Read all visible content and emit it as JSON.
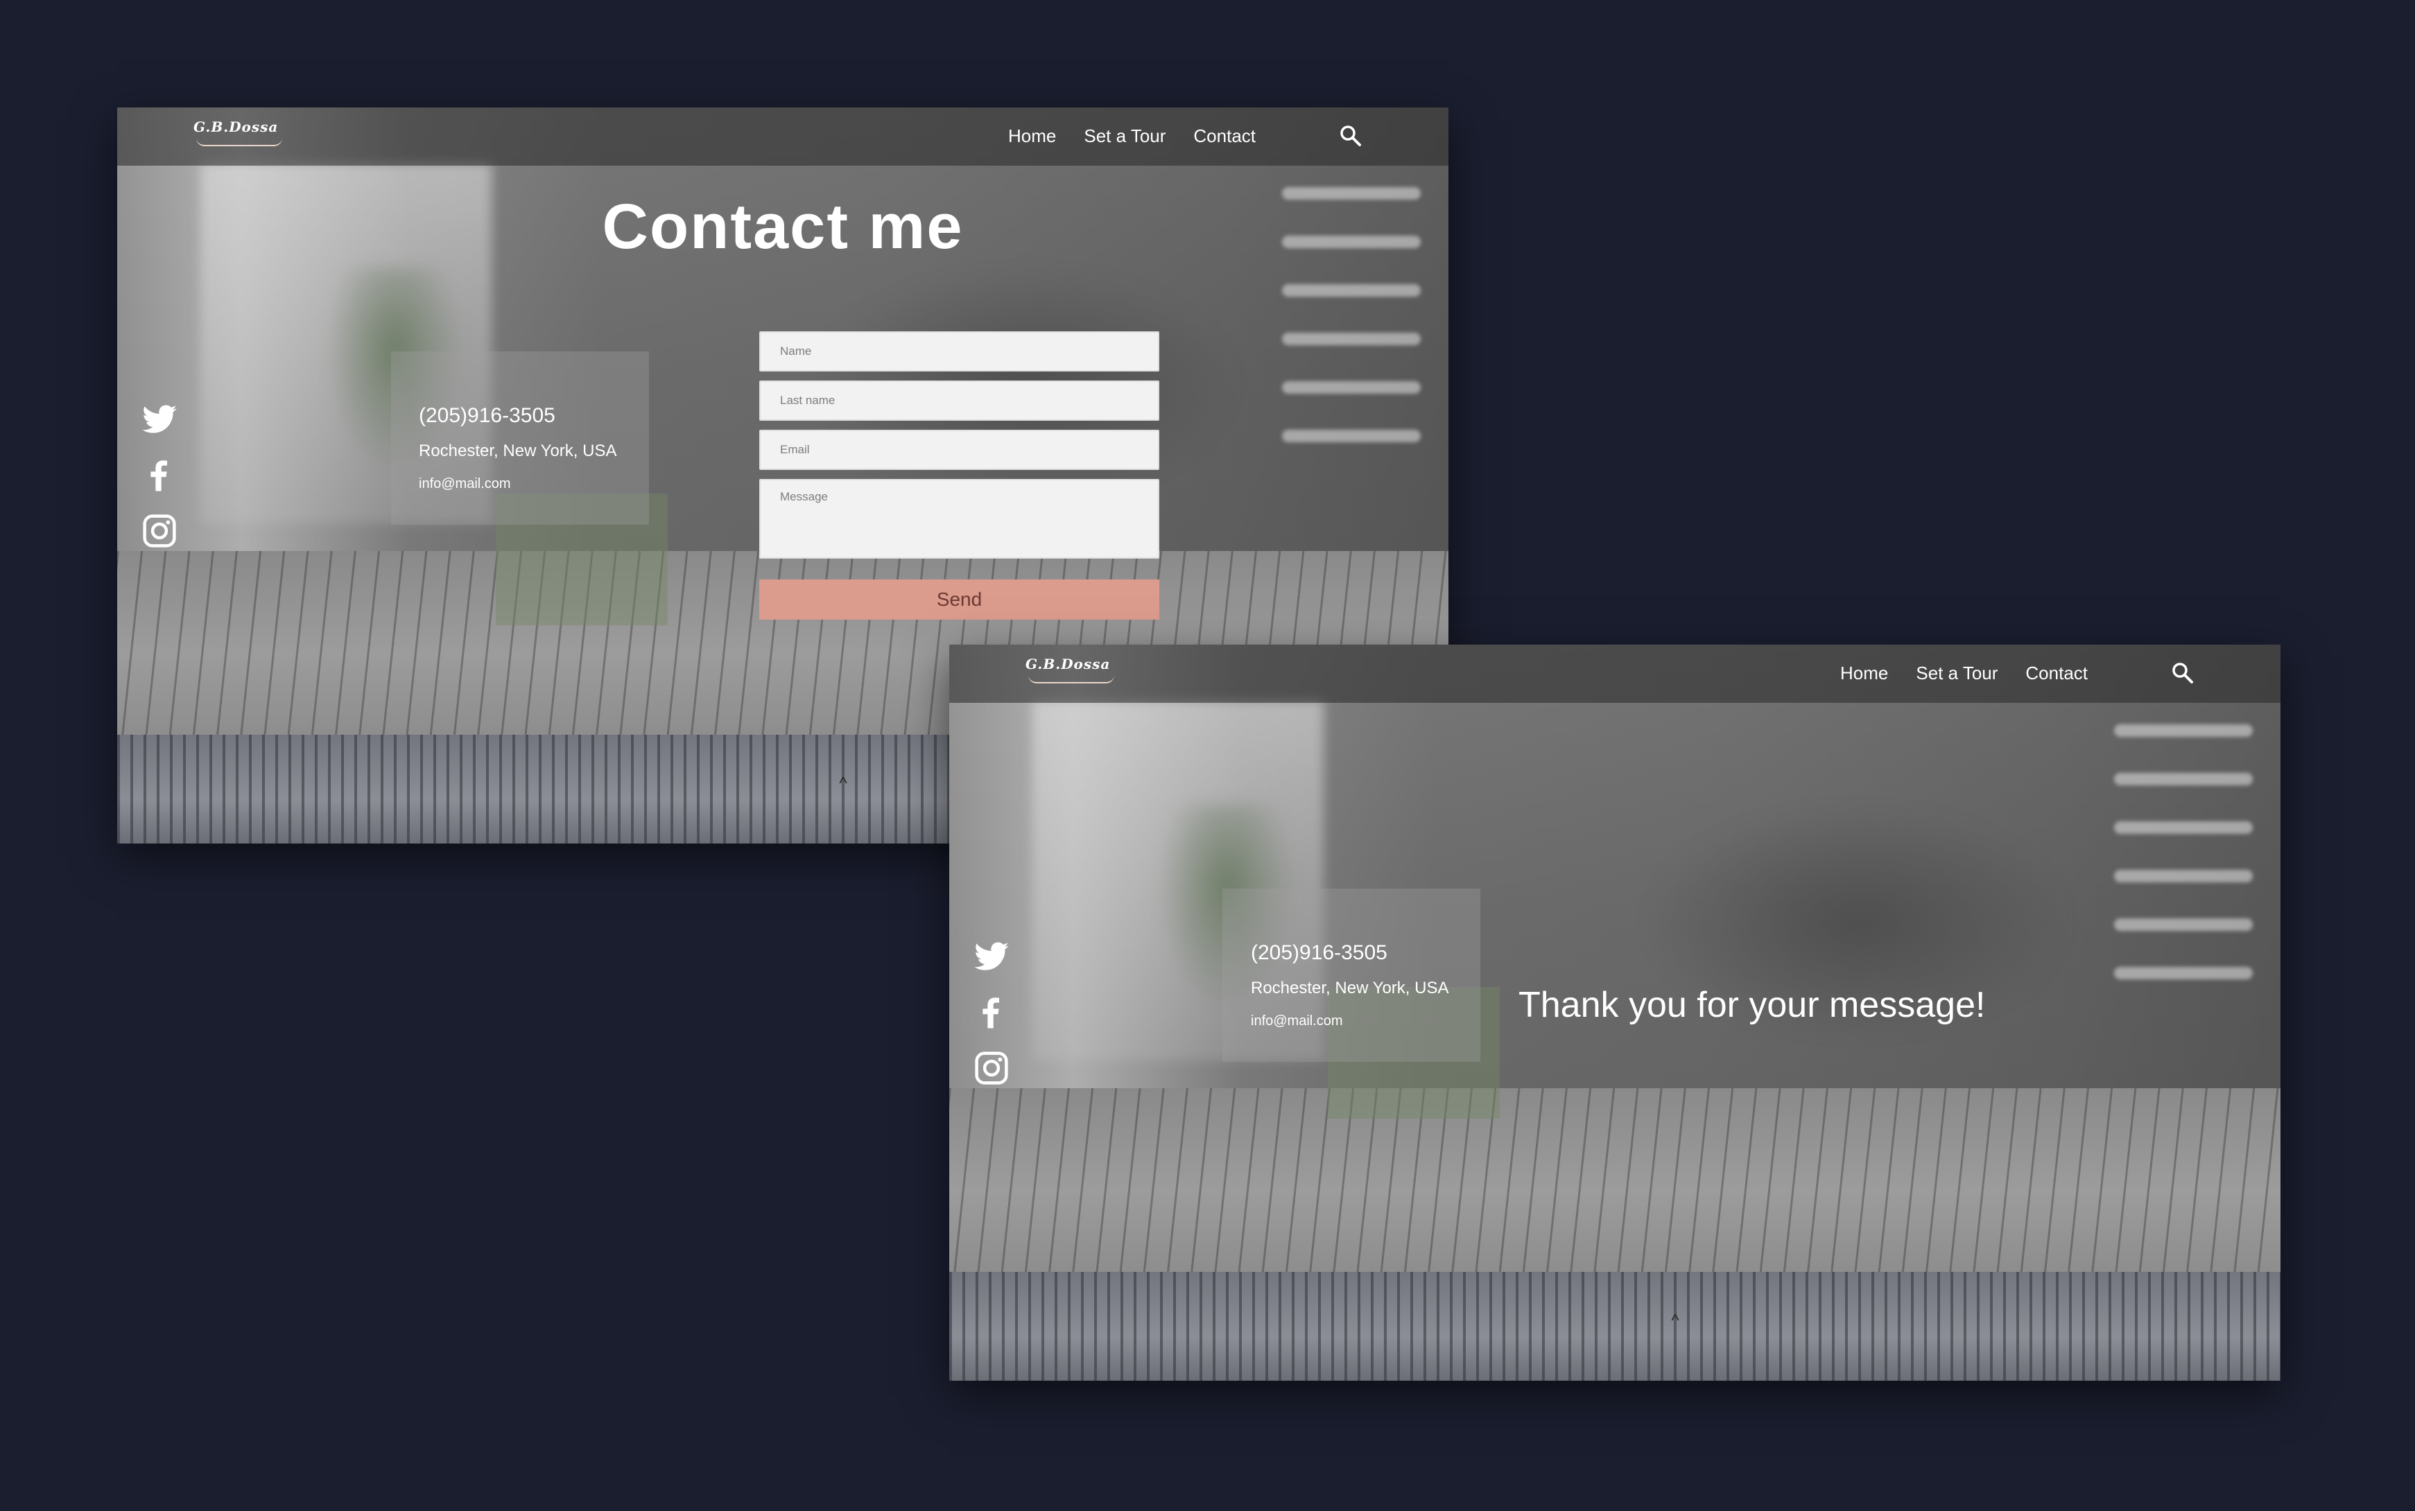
{
  "brand": {
    "logo_text": "G.B.Dossa"
  },
  "nav": {
    "items": [
      {
        "label": "Home"
      },
      {
        "label": "Set a Tour"
      },
      {
        "label": "Contact"
      }
    ]
  },
  "icons": {
    "search": "search-icon",
    "social": [
      "twitter-icon",
      "facebook-icon",
      "instagram-icon"
    ],
    "scroll_top": "chevron-up-icon"
  },
  "contact_page": {
    "title": "Contact me",
    "info": {
      "phone": "(205)916-3505",
      "address": "Rochester, New York, USA",
      "email": "info@mail.com"
    },
    "form": {
      "name_placeholder": "Name",
      "lastname_placeholder": "Last name",
      "email_placeholder": "Email",
      "message_placeholder": "Message",
      "send_label": "Send"
    }
  },
  "thanks_page": {
    "message": "Thank you for your message!",
    "info": {
      "phone": "(205)916-3505",
      "address": "Rochester, New York, USA",
      "email": "info@mail.com"
    }
  },
  "colors": {
    "canvas": "#1b1e2f",
    "send_button": "#db9b8d",
    "info_accent": "#768768",
    "text": "#ffffff"
  },
  "scroll_top_glyph": "^"
}
